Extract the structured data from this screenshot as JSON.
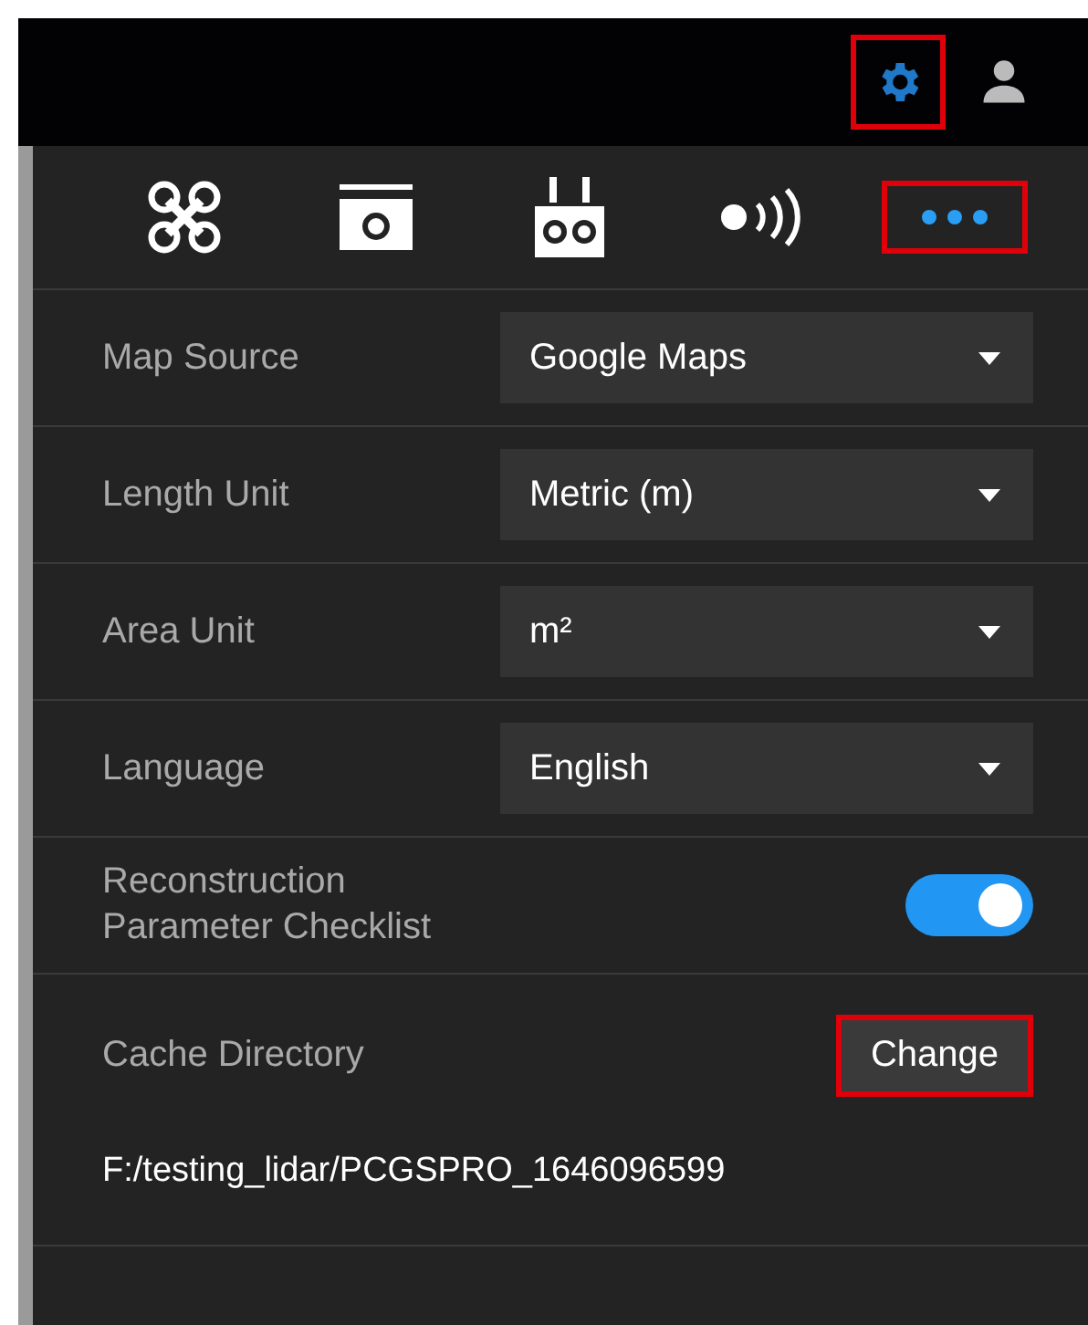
{
  "top_bar": {
    "icons": [
      {
        "kind": "gear",
        "selected": true,
        "highlighted": true
      },
      {
        "kind": "user",
        "selected": false,
        "highlighted": false
      }
    ]
  },
  "tabs": [
    {
      "kind": "drone",
      "selected": false,
      "highlighted": false
    },
    {
      "kind": "camera",
      "selected": false,
      "highlighted": false
    },
    {
      "kind": "remote",
      "selected": false,
      "highlighted": false
    },
    {
      "kind": "signal",
      "selected": false,
      "highlighted": false
    },
    {
      "kind": "more",
      "selected": true,
      "highlighted": true
    }
  ],
  "settings": [
    {
      "kind": "select",
      "label": "Map Source",
      "value": "Google Maps"
    },
    {
      "kind": "select",
      "label": "Length Unit",
      "value": "Metric (m)"
    },
    {
      "kind": "select",
      "label": "Area Unit",
      "value": "m²"
    },
    {
      "kind": "select",
      "label": "Language",
      "value": "English"
    },
    {
      "kind": "toggle",
      "label": "Reconstruction\nParameter Checklist",
      "on": true
    },
    {
      "kind": "directory",
      "label": "Cache Directory",
      "button": "Change",
      "button_highlighted": true,
      "path": "F:/testing_lidar/PCGSPRO_1646096599"
    }
  ]
}
